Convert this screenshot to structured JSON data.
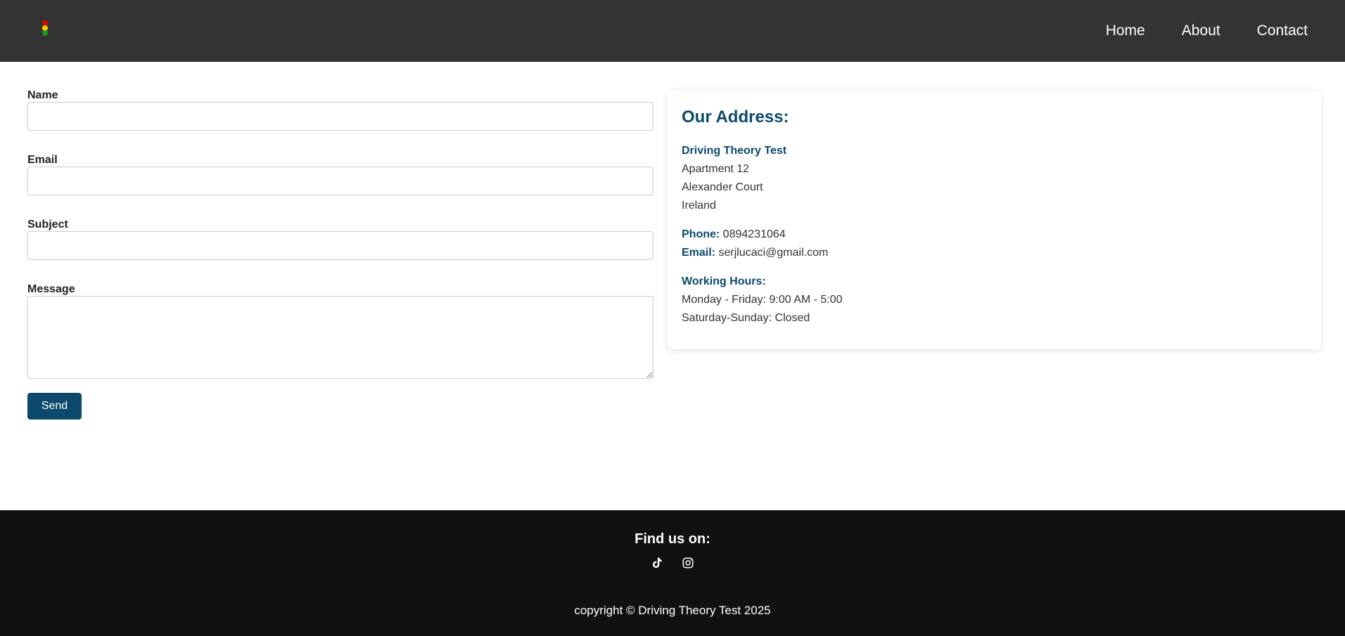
{
  "nav": {
    "items": [
      {
        "label": "Home"
      },
      {
        "label": "About"
      },
      {
        "label": "Contact"
      }
    ]
  },
  "logo": {
    "colors": [
      "#e00000",
      "#f5d000",
      "#1a9a1a"
    ],
    "icon": "traffic-light-icon"
  },
  "form": {
    "name_label": "Name",
    "name_value": "",
    "email_label": "Email",
    "email_value": "",
    "subject_label": "Subject",
    "subject_value": "",
    "message_label": "Message",
    "message_value": "",
    "send_label": "Send"
  },
  "address": {
    "title": "Our Address:",
    "company": "Driving Theory Test",
    "line1": "Apartment 12",
    "line2": "Alexander Court",
    "line3": "Ireland",
    "phone_label": "Phone:",
    "phone": "0894231064",
    "email_label": "Email:",
    "email": "serjlucaci@gmail.com",
    "hours_title": "Working Hours:",
    "hours_weekday": "Monday - Friday: 9:00 AM - 5:00",
    "hours_weekend": "Saturday-Sunday: Closed"
  },
  "footer": {
    "find_us": "Find us on:",
    "social": [
      {
        "icon": "tiktok-icon"
      },
      {
        "icon": "instagram-icon"
      }
    ],
    "copyright": "copyright © Driving Theory Test 2025"
  },
  "colors": {
    "header_bg": "#333333",
    "footer_bg": "#111111",
    "accent": "#0b4a6b"
  }
}
